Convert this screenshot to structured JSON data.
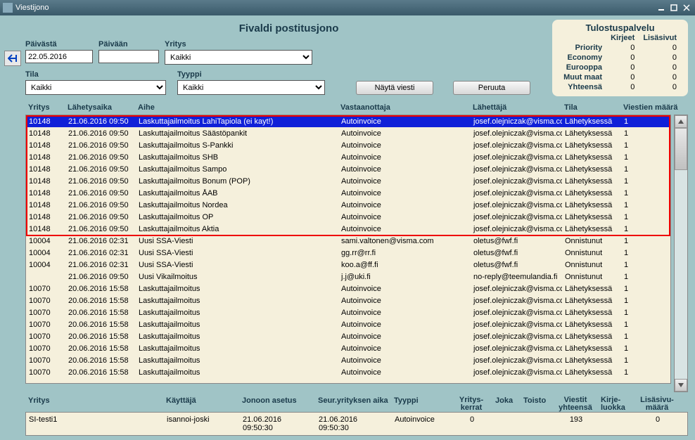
{
  "window": {
    "title": "Viestijono"
  },
  "header": {
    "title": "Fivaldi postitusjono"
  },
  "stats": {
    "title": "Tulostuspalvelu",
    "cols": [
      "Kirjeet",
      "Lisäsivut"
    ],
    "rows": [
      {
        "label": "Priority",
        "a": "0",
        "b": "0"
      },
      {
        "label": "Economy",
        "a": "0",
        "b": "0"
      },
      {
        "label": "Eurooppa",
        "a": "0",
        "b": "0"
      },
      {
        "label": "Muut maat",
        "a": "0",
        "b": "0"
      },
      {
        "label": "Yhteensä",
        "a": "0",
        "b": "0"
      }
    ]
  },
  "filters": {
    "paivasta_label": "Päivästä",
    "paivasta": "22.05.2016",
    "paivaan_label": "Päivään",
    "paivaan": "",
    "yritys_label": "Yritys",
    "yritys": "Kaikki",
    "tila_label": "Tila",
    "tila": "Kaikki",
    "tyyppi_label": "Tyyppi",
    "tyyppi": "Kaikki",
    "nayta": "Näytä viesti",
    "peruuta": "Peruuta"
  },
  "columns": {
    "yritys": "Yritys",
    "aika": "Lähetysaika",
    "aihe": "Aihe",
    "vast": "Vastaanottaja",
    "lah": "Lähettäjä",
    "tila": "Tila",
    "maara": "Viestien määrä"
  },
  "rows": [
    {
      "y": "10148",
      "a": "21.06.2016 09:50",
      "s": "Laskuttajailmoitus LahiTapiola (ei kayt!)",
      "v": "Autoinvoice",
      "l": "josef.olejniczak@visma.com",
      "t": "Lähetyksessä",
      "m": "1",
      "sel": true
    },
    {
      "y": "10148",
      "a": "21.06.2016 09:50",
      "s": "Laskuttajailmoitus Säästöpankit",
      "v": "Autoinvoice",
      "l": "josef.olejniczak@visma.com",
      "t": "Lähetyksessä",
      "m": "1"
    },
    {
      "y": "10148",
      "a": "21.06.2016 09:50",
      "s": "Laskuttajailmoitus S-Pankki",
      "v": "Autoinvoice",
      "l": "josef.olejniczak@visma.com",
      "t": "Lähetyksessä",
      "m": "1"
    },
    {
      "y": "10148",
      "a": "21.06.2016 09:50",
      "s": "Laskuttajailmoitus SHB",
      "v": "Autoinvoice",
      "l": "josef.olejniczak@visma.com",
      "t": "Lähetyksessä",
      "m": "1"
    },
    {
      "y": "10148",
      "a": "21.06.2016 09:50",
      "s": "Laskuttajailmoitus Sampo",
      "v": "Autoinvoice",
      "l": "josef.olejniczak@visma.com",
      "t": "Lähetyksessä",
      "m": "1"
    },
    {
      "y": "10148",
      "a": "21.06.2016 09:50",
      "s": "Laskuttajailmoitus Bonum (POP)",
      "v": "Autoinvoice",
      "l": "josef.olejniczak@visma.com",
      "t": "Lähetyksessä",
      "m": "1"
    },
    {
      "y": "10148",
      "a": "21.06.2016 09:50",
      "s": "Laskuttajailmoitus ÅAB",
      "v": "Autoinvoice",
      "l": "josef.olejniczak@visma.com",
      "t": "Lähetyksessä",
      "m": "1"
    },
    {
      "y": "10148",
      "a": "21.06.2016 09:50",
      "s": "Laskuttajailmoitus Nordea",
      "v": "Autoinvoice",
      "l": "josef.olejniczak@visma.com",
      "t": "Lähetyksessä",
      "m": "1"
    },
    {
      "y": "10148",
      "a": "21.06.2016 09:50",
      "s": "Laskuttajailmoitus OP",
      "v": "Autoinvoice",
      "l": "josef.olejniczak@visma.com",
      "t": "Lähetyksessä",
      "m": "1"
    },
    {
      "y": "10148",
      "a": "21.06.2016 09:50",
      "s": "Laskuttajailmoitus Aktia",
      "v": "Autoinvoice",
      "l": "josef.olejniczak@visma.com",
      "t": "Lähetyksessä",
      "m": "1"
    },
    {
      "y": "10004",
      "a": "21.06.2016 02:31",
      "s": "Uusi SSA-Viesti",
      "v": "sami.valtonen@visma.com",
      "l": "oletus@fwf.fi",
      "t": "Onnistunut",
      "m": "1"
    },
    {
      "y": "10004",
      "a": "21.06.2016 02:31",
      "s": "Uusi SSA-Viesti",
      "v": "gg.rr@rr.fi",
      "l": "oletus@fwf.fi",
      "t": "Onnistunut",
      "m": "1"
    },
    {
      "y": "10004",
      "a": "21.06.2016 02:31",
      "s": "Uusi SSA-Viesti",
      "v": "koo.a@ff.fi",
      "l": "oletus@fwf.fi",
      "t": "Onnistunut",
      "m": "1"
    },
    {
      "y": "",
      "a": "21.06.2016 09:50",
      "s": "Uusi Vikailmoitus",
      "v": "j.j@uki.fi",
      "l": "no-reply@teemulandia.fi",
      "t": "Onnistunut",
      "m": "1"
    },
    {
      "y": "10070",
      "a": "20.06.2016 15:58",
      "s": "Laskuttajailmoitus",
      "v": "Autoinvoice",
      "l": "josef.olejniczak@visma.com",
      "t": "Lähetyksessä",
      "m": "1"
    },
    {
      "y": "10070",
      "a": "20.06.2016 15:58",
      "s": "Laskuttajailmoitus",
      "v": "Autoinvoice",
      "l": "josef.olejniczak@visma.com",
      "t": "Lähetyksessä",
      "m": "1"
    },
    {
      "y": "10070",
      "a": "20.06.2016 15:58",
      "s": "Laskuttajailmoitus",
      "v": "Autoinvoice",
      "l": "josef.olejniczak@visma.com",
      "t": "Lähetyksessä",
      "m": "1"
    },
    {
      "y": "10070",
      "a": "20.06.2016 15:58",
      "s": "Laskuttajailmoitus",
      "v": "Autoinvoice",
      "l": "josef.olejniczak@visma.com",
      "t": "Lähetyksessä",
      "m": "1"
    },
    {
      "y": "10070",
      "a": "20.06.2016 15:58",
      "s": "Laskuttajailmoitus",
      "v": "Autoinvoice",
      "l": "josef.olejniczak@visma.com",
      "t": "Lähetyksessä",
      "m": "1"
    },
    {
      "y": "10070",
      "a": "20.06.2016 15:58",
      "s": "Laskuttajailmoitus",
      "v": "Autoinvoice",
      "l": "josef.olejniczak@visma.com",
      "t": "Lähetyksessä",
      "m": "1"
    },
    {
      "y": "10070",
      "a": "20.06.2016 15:58",
      "s": "Laskuttajailmoitus",
      "v": "Autoinvoice",
      "l": "josef.olejniczak@visma.com",
      "t": "Lähetyksessä",
      "m": "1"
    },
    {
      "y": "10070",
      "a": "20.06.2016 15:58",
      "s": "Laskuttajailmoitus",
      "v": "Autoinvoice",
      "l": "josef.olejniczak@visma.com",
      "t": "Lähetyksessä",
      "m": "1"
    }
  ],
  "footer": {
    "labels": {
      "yritys": "Yritys",
      "kayttaja": "Käyttäjä",
      "jonoon": "Jonoon asetus",
      "seur": "Seur.yrityksen aika",
      "tyyppi": "Tyyppi",
      "yk1": "Yritys-",
      "yk2": "kerrat",
      "joka": "Joka",
      "toisto": "Toisto",
      "vy1": "Viestit",
      "vy2": "yhteensä",
      "kl1": "Kirje-",
      "kl2": "luokka",
      "lm1": "Lisäsivu-",
      "lm2": "määrä"
    },
    "data": {
      "yritys": "SI-testi1",
      "kayttaja": "isannoi-joski",
      "jonoon": "21.06.2016 09:50:30",
      "seur": "21.06.2016 09:50:30",
      "tyyppi": "Autoinvoice",
      "yk": "0",
      "joka": "",
      "toisto": "",
      "vy": "193",
      "kl": "",
      "lm": "0"
    }
  }
}
